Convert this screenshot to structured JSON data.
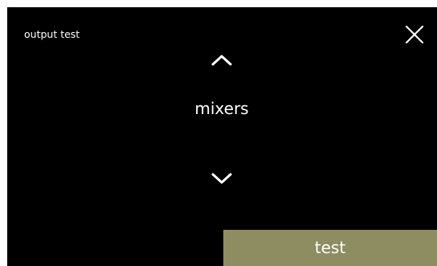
{
  "screen": {
    "title": "output test",
    "background_color": "#000000",
    "text_color": "#ffffff"
  },
  "close": {
    "icon": "close-icon"
  },
  "selector": {
    "up_icon": "chevron-up-icon",
    "current_item": "mixers",
    "down_icon": "chevron-down-icon"
  },
  "action": {
    "test_label": "test",
    "color": "#8d8d61"
  }
}
